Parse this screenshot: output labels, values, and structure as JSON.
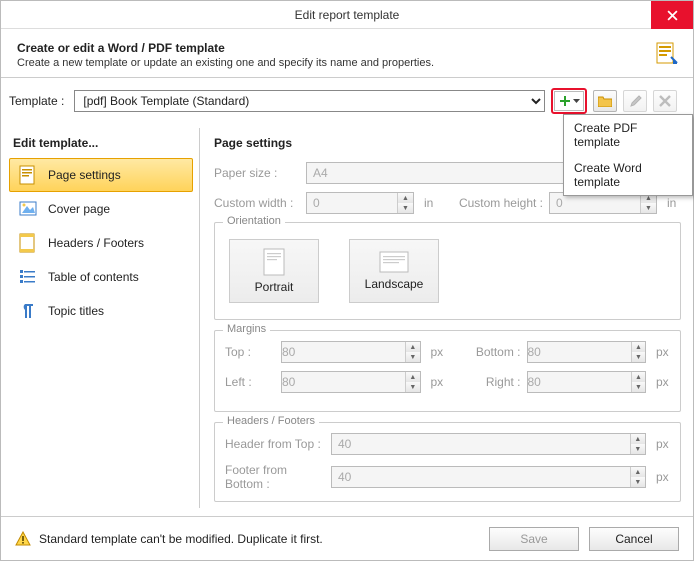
{
  "window": {
    "title": "Edit report template"
  },
  "header": {
    "title": "Create or edit a Word / PDF template",
    "subtitle": "Create a new template or update an existing one and specify its name and properties."
  },
  "template": {
    "label": "Template :",
    "selected": "[pdf] Book Template (Standard)"
  },
  "add_menu": {
    "item_pdf": "Create PDF template",
    "item_word": "Create Word template"
  },
  "side": {
    "heading": "Edit template...",
    "items": {
      "page_settings": "Page settings",
      "cover_page": "Cover page",
      "headers_footers": "Headers / Footers",
      "toc": "Table of contents",
      "topic_titles": "Topic titles"
    }
  },
  "page_settings": {
    "heading": "Page settings",
    "paper_size_label": "Paper size :",
    "paper_size_value": "A4",
    "custom_width_label": "Custom width :",
    "custom_width_value": "0",
    "custom_height_label": "Custom height :",
    "custom_height_value": "0",
    "unit_in": "in",
    "orientation_label": "Orientation",
    "portrait": "Portrait",
    "landscape": "Landscape",
    "margins_label": "Margins",
    "top_label": "Top :",
    "top_value": "80",
    "bottom_label": "Bottom :",
    "bottom_value": "80",
    "left_label": "Left :",
    "left_value": "80",
    "right_label": "Right :",
    "right_value": "80",
    "unit_px": "px",
    "hf_label": "Headers / Footers",
    "header_top_label": "Header from Top :",
    "header_top_value": "40",
    "footer_bottom_label": "Footer from Bottom :",
    "footer_bottom_value": "40"
  },
  "footer": {
    "warning": "Standard template can't be modified. Duplicate it first.",
    "save": "Save",
    "cancel": "Cancel"
  }
}
